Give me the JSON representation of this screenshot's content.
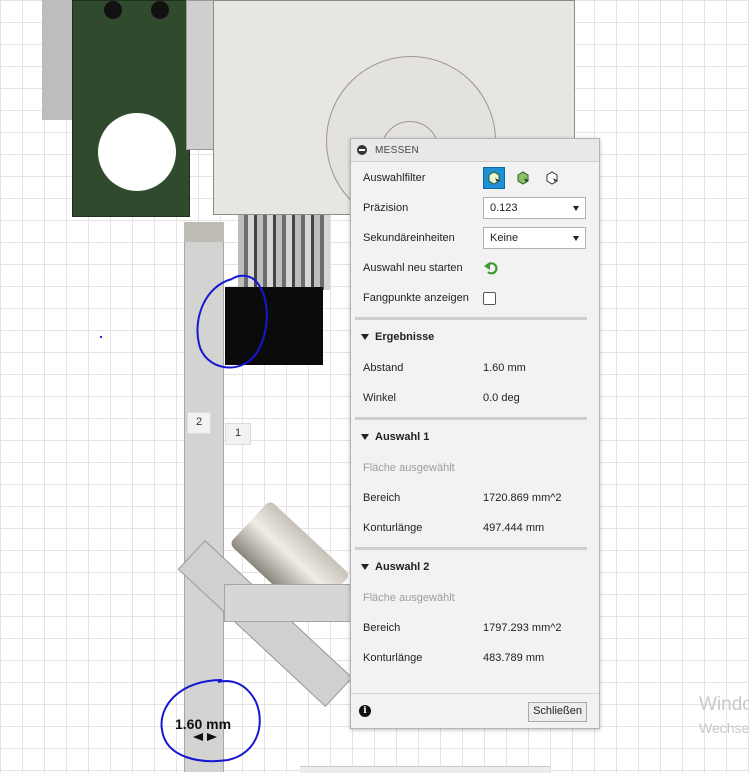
{
  "canvas": {
    "point_labels": [
      "2",
      "1"
    ],
    "dimension_label": "1.60 mm",
    "watermark": [
      "Windo",
      "Wechse"
    ]
  },
  "panel": {
    "title": "MESSEN",
    "rows": {
      "filter_label": "Auswahlfilter",
      "precision_label": "Präzision",
      "precision_value": "0.123",
      "secondary_units_label": "Sekundäreinheiten",
      "secondary_units_value": "Keine",
      "restart_label": "Auswahl neu starten",
      "snap_label": "Fangpunkte anzeigen"
    },
    "results": {
      "header": "Ergebnisse",
      "distance_label": "Abstand",
      "distance_value": "1.60 mm",
      "angle_label": "Winkel",
      "angle_value": "0.0 deg"
    },
    "selection1": {
      "header": "Auswahl 1",
      "status": "Fläche ausgewählt",
      "area_label": "Bereich",
      "area_value": "1720.869 mm^2",
      "perimeter_label": "Konturlänge",
      "perimeter_value": "497.444 mm"
    },
    "selection2": {
      "header": "Auswahl 2",
      "status": "Fläche ausgewählt",
      "area_label": "Bereich",
      "area_value": "1797.293 mm^2",
      "perimeter_label": "Konturlänge",
      "perimeter_value": "483.789 mm"
    },
    "close_label": "Schließen",
    "accent_color": "#1e90d6"
  },
  "icons": [
    "select-body-filter-icon",
    "select-face-filter-icon",
    "select-edge-filter-icon",
    "restart-arrow-icon",
    "info-icon",
    "collapse-icon"
  ]
}
